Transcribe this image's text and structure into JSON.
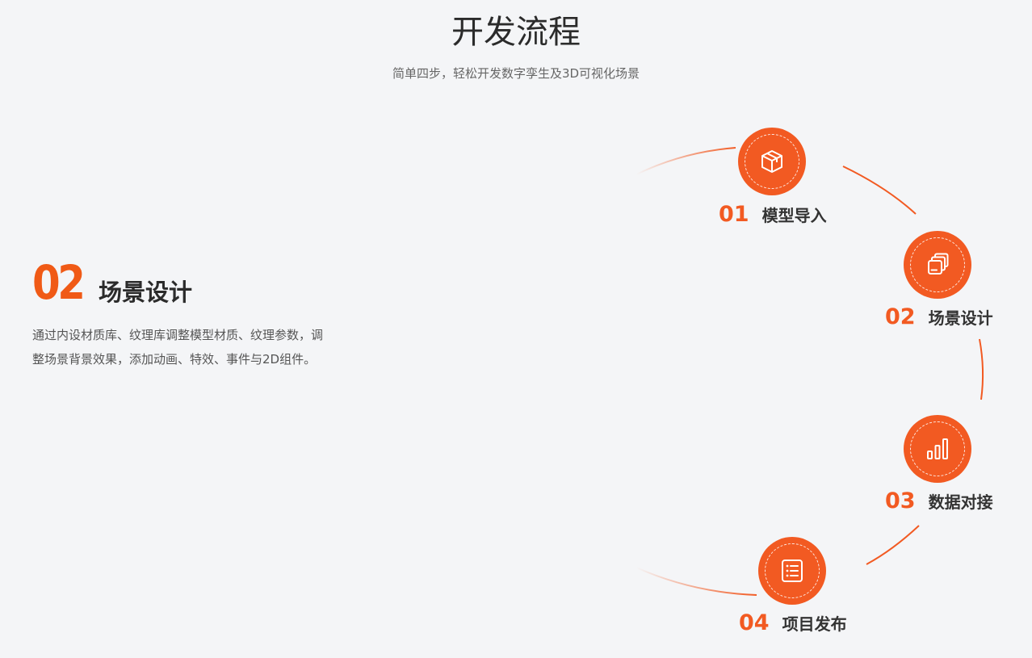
{
  "header": {
    "title": "开发流程",
    "subtitle": "简单四步，轻松开发数字孪生及3D可视化场景"
  },
  "active_step": {
    "number": "02",
    "title": "场景设计",
    "description": "通过内设材质库、纹理库调整模型材质、纹理参数，调整场景背景效果，添加动画、特效、事件与2D组件。"
  },
  "steps": [
    {
      "number": "01",
      "label": "模型导入",
      "icon": "cube-icon"
    },
    {
      "number": "02",
      "label": "场景设计",
      "icon": "layers-icon"
    },
    {
      "number": "03",
      "label": "数据对接",
      "icon": "bar-chart-icon"
    },
    {
      "number": "04",
      "label": "项目发布",
      "icon": "list-document-icon"
    }
  ],
  "colors": {
    "accent": "#f25a22",
    "background": "#f4f5f7",
    "title": "#2b2b2b",
    "text": "#555555"
  }
}
